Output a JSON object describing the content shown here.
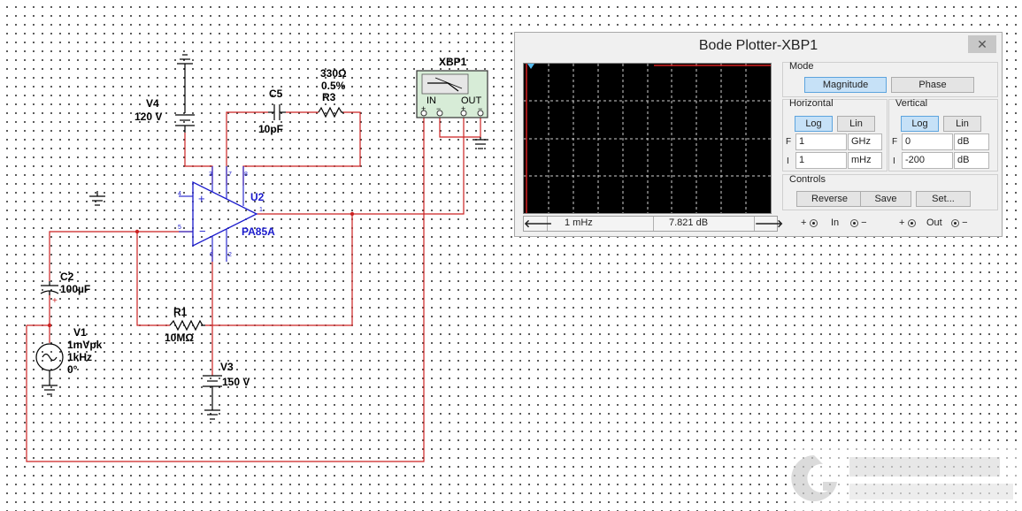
{
  "schematic": {
    "v4": {
      "name": "V4",
      "value": "120 V"
    },
    "c5": {
      "name": "C5",
      "value": "10pF"
    },
    "r3": {
      "name": "R3",
      "value": "330Ω",
      "tolerance": "0.5%"
    },
    "u2": {
      "name": "U2",
      "part": "PA85A",
      "pins": [
        "3",
        "7",
        "8",
        "4",
        "5",
        "1",
        "6",
        "2"
      ]
    },
    "c2": {
      "name": "C2",
      "value": "100µF",
      "polarity": "+"
    },
    "v1": {
      "name": "V1",
      "amplitude": "1mVpk",
      "freq": "1kHz",
      "phase": "0°"
    },
    "r1": {
      "name": "R1",
      "value": "10MΩ"
    },
    "v3": {
      "name": "V3",
      "value": "150 V"
    },
    "xbp": {
      "name": "XBP1",
      "in": "IN",
      "out": "OUT",
      "plus": "+",
      "minus": "−"
    },
    "wire_color": "#cc2222",
    "part_color": "#1a1acc"
  },
  "bode": {
    "title": "Bode Plotter-XBP1",
    "close": "✕",
    "mode": {
      "label": "Mode",
      "magnitude": "Magnitude",
      "phase": "Phase",
      "selected": "Magnitude"
    },
    "horizontal": {
      "label": "Horizontal",
      "log": "Log",
      "lin": "Lin",
      "selected": "Log",
      "F": {
        "letter": "F",
        "value": "1",
        "unit": "GHz"
      },
      "I": {
        "letter": "I",
        "value": "1",
        "unit": "mHz"
      }
    },
    "vertical": {
      "label": "Vertical",
      "log": "Log",
      "lin": "Lin",
      "selected": "Log",
      "F": {
        "letter": "F",
        "value": "0",
        "unit": "dB"
      },
      "I": {
        "letter": "I",
        "value": "-200",
        "unit": "dB"
      }
    },
    "controls": {
      "label": "Controls",
      "reverse": "Reverse",
      "save": "Save",
      "set": "Set..."
    },
    "readout": {
      "left_arrow": "🡐",
      "right_arrow": "🡒",
      "freq": "1 mHz",
      "value": "7.821 dB"
    },
    "terminals": {
      "plus": "+",
      "minus": "−",
      "in": "In",
      "out": "Out"
    },
    "screen_color": "#000000",
    "trace_color": "#d42020",
    "grid_color": "#cfcfcf"
  }
}
